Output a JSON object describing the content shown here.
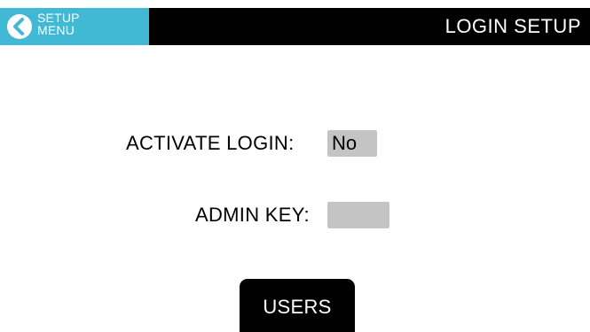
{
  "header": {
    "back_button": {
      "line1": "SETUP",
      "line2": "MENU",
      "icon": "chevron-left-circle-icon"
    },
    "title": "LOGIN SETUP"
  },
  "form": {
    "activate_login": {
      "label": "ACTIVATE LOGIN:",
      "value": "No"
    },
    "admin_key": {
      "label": "ADMIN KEY:",
      "value": ""
    }
  },
  "users_button": {
    "label": "USERS"
  },
  "colors": {
    "accent": "#42b9d4",
    "header_bg": "#000000",
    "field_bg": "#c4c4c4",
    "background": "#ffffff"
  }
}
